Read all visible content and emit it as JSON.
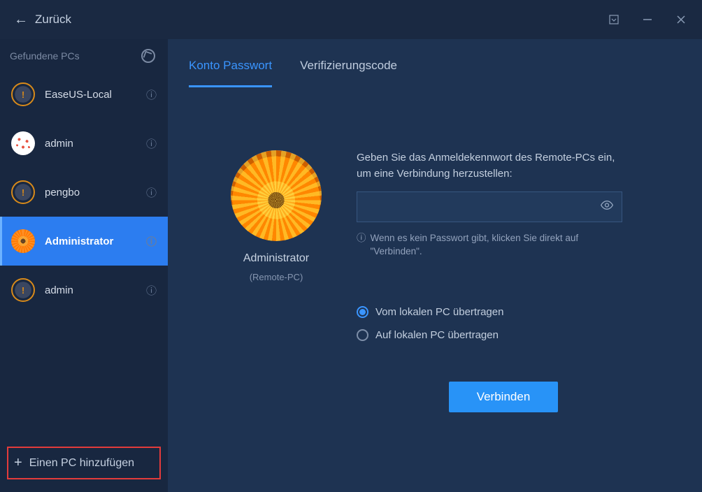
{
  "titlebar": {
    "back": "Zurück"
  },
  "sidebar": {
    "header": "Gefundene PCs",
    "items": [
      {
        "label": "EaseUS-Local",
        "avatar": "ring"
      },
      {
        "label": "admin",
        "avatar": "dots"
      },
      {
        "label": "pengbo",
        "avatar": "ring"
      },
      {
        "label": "Administrator",
        "avatar": "flower",
        "selected": true
      },
      {
        "label": "admin",
        "avatar": "ring"
      }
    ],
    "add": "Einen PC hinzufügen"
  },
  "tabs": {
    "password": "Konto Passwort",
    "code": "Verifizierungscode"
  },
  "user": {
    "name": "Administrator",
    "sub": "(Remote-PC)"
  },
  "form": {
    "prompt": "Geben Sie das Anmeldekennwort des Remote-PCs ein, um eine Verbindung herzustellen:",
    "hint": "Wenn es kein Passwort gibt, klicken Sie direkt auf \"Verbinden\".",
    "placeholder": ""
  },
  "radios": {
    "from": "Vom lokalen PC übertragen",
    "to": "Auf lokalen PC übertragen"
  },
  "actions": {
    "connect": "Verbinden"
  }
}
